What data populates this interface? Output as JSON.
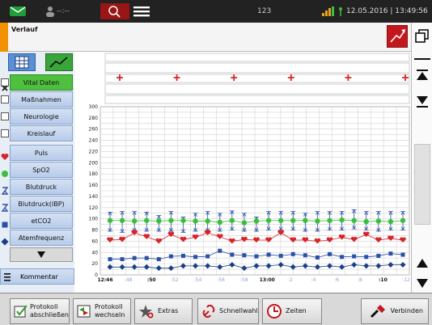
{
  "status": {
    "placeholder_time": "--:--",
    "center": "123",
    "datetime": "12.05.2016 | 13:49:56"
  },
  "title": "Verlauf",
  "nav": {
    "items": [
      {
        "label": "Vital Daten",
        "type": "check",
        "checked": true
      },
      {
        "label": "Maßnahmen",
        "type": "check",
        "checked": false
      },
      {
        "label": "Neurologie",
        "type": "check",
        "checked": false
      },
      {
        "label": "Kreislauf",
        "type": "check",
        "checked": false
      },
      {
        "label": "Puls",
        "type": "series",
        "icon": "heart-icon",
        "color": "#d9232b"
      },
      {
        "label": "SpO2",
        "type": "series",
        "icon": "circle-icon",
        "color": "#3cbf3c"
      },
      {
        "label": "Blutdruck",
        "type": "series",
        "icon": "bp-icon",
        "color": "#2c4fa8"
      },
      {
        "label": "Blutdruck(IBP)",
        "type": "series",
        "icon": "bp-icon",
        "color": "#2c4fa8"
      },
      {
        "label": "etCO2",
        "type": "series",
        "icon": "square-icon",
        "color": "#2c4fa8"
      },
      {
        "label": "Atemfrequenz",
        "type": "series",
        "icon": "diamond-icon",
        "color": "#1a3f86"
      }
    ],
    "comment_label": "Kommentar"
  },
  "bottom": {
    "buttons": [
      {
        "label1": "Protokoll",
        "label2": "abschließen",
        "icon": "close-protocol-icon"
      },
      {
        "label1": "Protokoll",
        "label2": "wechseln",
        "icon": "switch-protocol-icon"
      },
      {
        "label1": "Extras",
        "label2": "",
        "icon": "extras-icon"
      },
      {
        "label1": "Schnellwahl",
        "label2": "",
        "icon": "quickselect-icon"
      },
      {
        "label1": "Zeiten",
        "label2": "",
        "icon": "clock-icon"
      },
      {
        "label1": "Verbinden",
        "label2": "",
        "icon": "connect-icon"
      }
    ]
  },
  "chart_data": {
    "type": "line",
    "y_ticks": [
      "300",
      "280",
      "260",
      "240",
      "220",
      "200",
      "180",
      "160",
      "140",
      "120",
      "100",
      "80",
      "60",
      "40",
      "20",
      "0"
    ],
    "ylim": [
      0,
      300
    ],
    "x_ticks": [
      {
        "label": "12:46",
        "bold": true
      },
      {
        "label": ":48",
        "bold": false
      },
      {
        "label": ":50",
        "bold": true
      },
      {
        "label": ":52",
        "bold": false
      },
      {
        "label": ":54",
        "bold": false
      },
      {
        "label": ":56",
        "bold": false
      },
      {
        "label": ":58",
        "bold": false
      },
      {
        "label": "13:00",
        "bold": true
      },
      {
        "label": ":2",
        "bold": false
      },
      {
        "label": ":4",
        "bold": false
      },
      {
        "label": ":6",
        "bold": false
      },
      {
        "label": ":8",
        "bold": false
      },
      {
        "label": ":10",
        "bold": true
      },
      {
        "label": ":12",
        "bold": false
      }
    ],
    "grid": true,
    "series": [
      {
        "name": "SpO2",
        "marker": "circle",
        "color": "#3cbf3c",
        "values": [
          97,
          97,
          96,
          97,
          96,
          97,
          97,
          96,
          96,
          94,
          97,
          93,
          96,
          97,
          97,
          97,
          97,
          96,
          97,
          98,
          97,
          95,
          96,
          95,
          97
        ]
      },
      {
        "name": "Puls",
        "marker": "heart",
        "color": "#d9232b",
        "values": [
          62,
          63,
          75,
          68,
          60,
          72,
          63,
          67,
          75,
          68,
          60,
          63,
          62,
          62,
          75,
          62,
          62,
          60,
          62,
          67,
          63,
          72,
          62,
          65,
          62
        ]
      },
      {
        "name": "Blutdruck sys",
        "marker": "bp",
        "color": "#2c4fa8",
        "values": [
          112,
          113,
          113,
          112,
          106,
          113,
          103,
          110,
          113,
          110,
          114,
          110,
          103,
          113,
          113,
          113,
          110,
          113,
          113,
          113,
          116,
          113,
          113,
          113,
          113
        ]
      },
      {
        "name": "Blutdruck dia",
        "marker": "bp",
        "color": "#2c4fa8",
        "values": [
          78,
          76,
          78,
          78,
          78,
          78,
          76,
          78,
          78,
          78,
          80,
          78,
          78,
          80,
          80,
          80,
          78,
          78,
          80,
          80,
          82,
          80,
          78,
          80,
          80
        ]
      },
      {
        "name": "etCO2",
        "marker": "square",
        "color": "#2c4fa8",
        "values": [
          28,
          28,
          30,
          30,
          28,
          33,
          34,
          32,
          33,
          43,
          36,
          35,
          33,
          36,
          34,
          37,
          35,
          31,
          37,
          32,
          33,
          32,
          34,
          38,
          36
        ]
      },
      {
        "name": "Atemfrequenz",
        "marker": "diamond",
        "color": "#1a3f86",
        "values": [
          14,
          14,
          14,
          14,
          12,
          12,
          16,
          16,
          16,
          14,
          18,
          12,
          16,
          16,
          18,
          14,
          16,
          14,
          16,
          14,
          18,
          16,
          16,
          18,
          18
        ]
      }
    ],
    "event_markers": 6
  }
}
